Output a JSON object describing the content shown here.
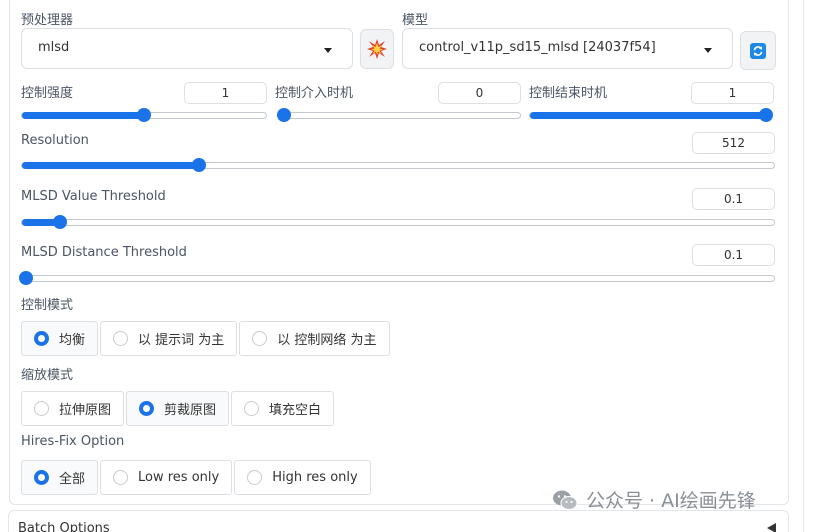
{
  "preprocessor": {
    "label": "预处理器",
    "value": "mlsd",
    "run_icon": "explosion-icon"
  },
  "model": {
    "label": "模型",
    "value": "control_v11p_sd15_mlsd [24037f54]",
    "refresh_icon": "refresh-icon"
  },
  "sliders": {
    "control_weight": {
      "label": "控制强度",
      "value": "1",
      "fraction": 0.5
    },
    "guidance_start": {
      "label": "控制介入时机",
      "value": "0",
      "fraction": 0.0
    },
    "guidance_end": {
      "label": "控制结束时机",
      "value": "1",
      "fraction": 1.0
    },
    "resolution": {
      "label": "Resolution",
      "value": "512",
      "fraction": 0.235
    },
    "mlsd_value_threshold": {
      "label": "MLSD Value Threshold",
      "value": "0.1",
      "fraction": 0.05
    },
    "mlsd_distance_threshold": {
      "label": "MLSD Distance Threshold",
      "value": "0.1",
      "fraction": 0.005
    }
  },
  "control_mode": {
    "label": "控制模式",
    "options": [
      "均衡",
      "以 提示词 为主",
      "以 控制网络 为主"
    ],
    "selected": 0
  },
  "resize_mode": {
    "label": "缩放模式",
    "options": [
      "拉伸原图",
      "剪裁原图",
      "填充空白"
    ],
    "selected": 1
  },
  "hires_fix": {
    "label": "Hires-Fix Option",
    "options": [
      "全部",
      "Low res only",
      "High res only"
    ],
    "selected": 0
  },
  "batch_options": {
    "label": "Batch Options"
  },
  "watermark": {
    "text": "公众号 · AI绘画先锋"
  },
  "colors": {
    "accent": "#1a73e8",
    "border": "#dcdfe4",
    "label": "#4b5563"
  }
}
